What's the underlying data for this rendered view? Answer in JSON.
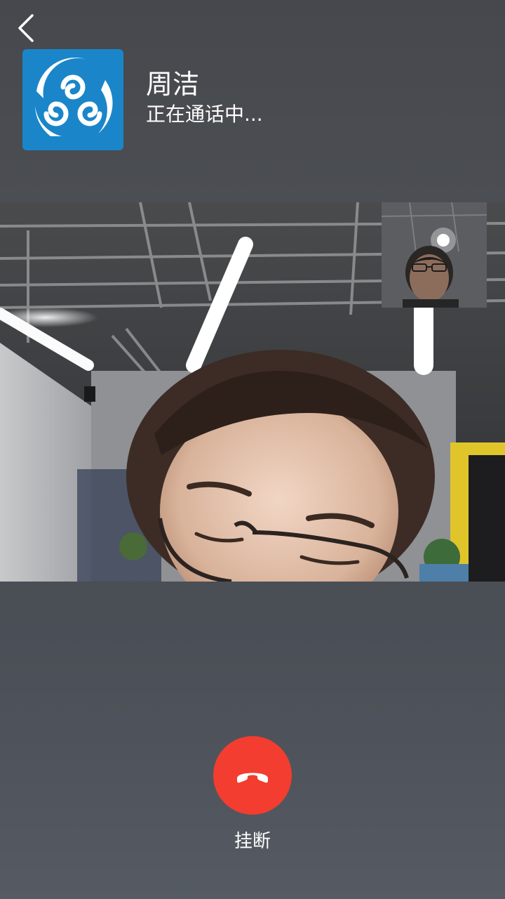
{
  "contact": {
    "name": "周洁",
    "status": "正在通话中..."
  },
  "icons": {
    "back": "chevron-left-icon",
    "avatar": "swirl-logo",
    "hangup": "phone-hangup-icon"
  },
  "controls": {
    "hangup_label": "挂断"
  },
  "colors": {
    "hangup": "#f23d30",
    "avatar_bg": "#1a86c9"
  }
}
